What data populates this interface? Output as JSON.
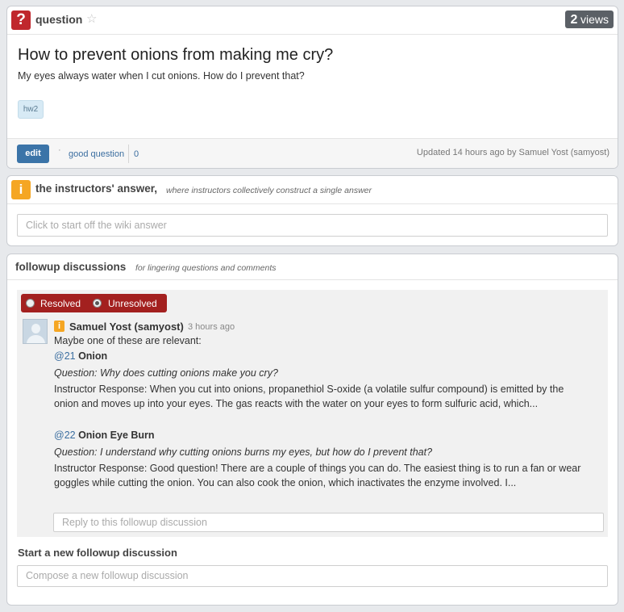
{
  "question": {
    "label": "question",
    "views_num": "2",
    "views_label": "views",
    "title": "How to prevent onions from making me cry?",
    "body": "My eyes always water when I cut onions. How do I prevent that?",
    "tag": "hw2",
    "edit_label": "edit",
    "good_question_label": "good question",
    "good_question_count": "0",
    "updated": "Updated 14 hours ago by Samuel Yost (samyost)"
  },
  "instructors": {
    "label": "the instructors' answer,",
    "sublabel": "where instructors collectively construct a single answer",
    "placeholder": "Click to start off the wiki answer"
  },
  "followup": {
    "label": "followup discussions",
    "sublabel": "for lingering questions and comments",
    "resolved_label": "Resolved",
    "unresolved_label": "Unresolved",
    "post": {
      "author": "Samuel Yost (samyost)",
      "time": "3 hours ago",
      "intro": "Maybe one of these are relevant:",
      "refs": [
        {
          "num": "@21",
          "title": "Onion",
          "question": "Question: Why does cutting onions make you cry?",
          "response_line1": "Instructor Response: When you cut into onions, propanethiol S-oxide (a volatile sulfur compound) is emitted by the",
          "response_line2": "onion and moves up into your eyes. The gas reacts with the water on your eyes to form sulfuric acid, which..."
        },
        {
          "num": "@22",
          "title": "Onion Eye Burn",
          "question": "Question: I understand why cutting onions burns my eyes, but how do I prevent that?",
          "response_line1": "Instructor Response: Good question! There are a couple of things you can do. The easiest thing is to run a fan or wear",
          "response_line2": "goggles while cutting the onion. You can also cook the onion, which inactivates the enzyme involved. I..."
        }
      ]
    },
    "reply_placeholder": "Reply to this followup discussion",
    "new_label": "Start a new followup discussion",
    "compose_placeholder": "Compose a new followup discussion"
  },
  "colors": {
    "question_icon": "#c0272d",
    "info_icon": "#f5a623",
    "resolved_bar": "#a3201f",
    "edit_button": "#3b74a8",
    "link": "#3b6ea0"
  },
  "icons": [
    "question-icon",
    "star-icon",
    "info-icon",
    "avatar-icon"
  ]
}
